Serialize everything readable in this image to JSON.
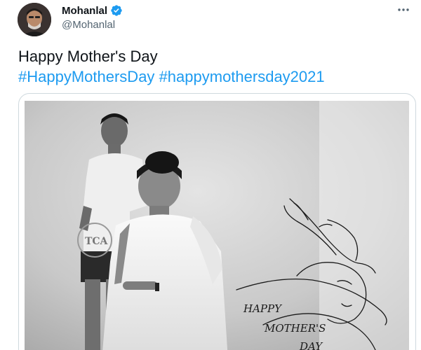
{
  "user": {
    "display_name": "Mohanlal",
    "handle": "@Mohanlal",
    "verified": true,
    "avatar_icon": "profile-photo",
    "more_icon": "more-horizontal-icon"
  },
  "tweet": {
    "text": "Happy Mother's Day",
    "hashtags": [
      "#HappyMothersDay",
      "#happymothersday2021"
    ]
  },
  "media": {
    "type": "photo",
    "stamp_text": "TCA",
    "sketch_caption": [
      "HAPPY",
      "MOTHER'S",
      "DAY"
    ]
  },
  "colors": {
    "link": "#1d9bf0",
    "verified": "#1d9bf0",
    "secondary_text": "#536471",
    "border": "#cfd9de"
  }
}
